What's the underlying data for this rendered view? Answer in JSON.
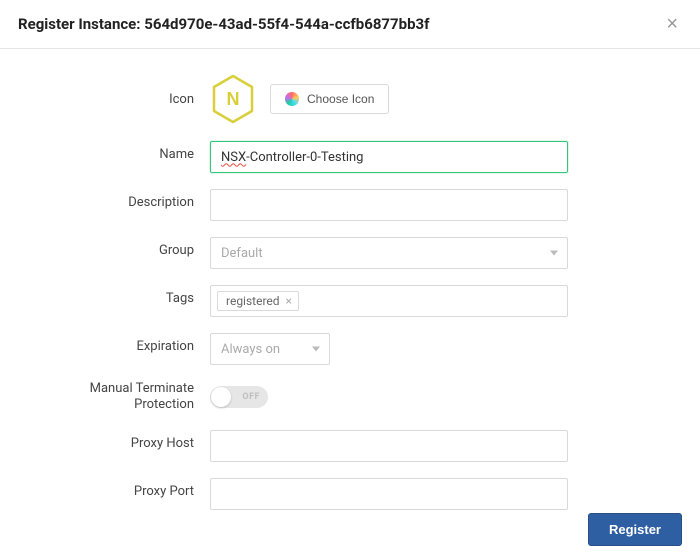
{
  "header": {
    "title": "Register Instance: 564d970e-43ad-55f4-544a-ccfb6877bb3f"
  },
  "form": {
    "labels": {
      "icon": "Icon",
      "name": "Name",
      "description": "Description",
      "group": "Group",
      "tags": "Tags",
      "expiration": "Expiration",
      "mtp_line1": "Manual Terminate",
      "mtp_line2": "Protection",
      "proxy_host": "Proxy Host",
      "proxy_port": "Proxy Port"
    },
    "icon_letter": "N",
    "choose_icon_label": "Choose Icon",
    "name_value_prefix": "NSX",
    "name_value_rest": "-Controller-0-Testing",
    "description_value": "",
    "group_placeholder": "Default",
    "tags": [
      "registered"
    ],
    "expiration_value": "Always on",
    "toggle_off_text": "OFF",
    "proxy_host_value": "",
    "proxy_port_value": ""
  },
  "footer": {
    "register_label": "Register"
  }
}
